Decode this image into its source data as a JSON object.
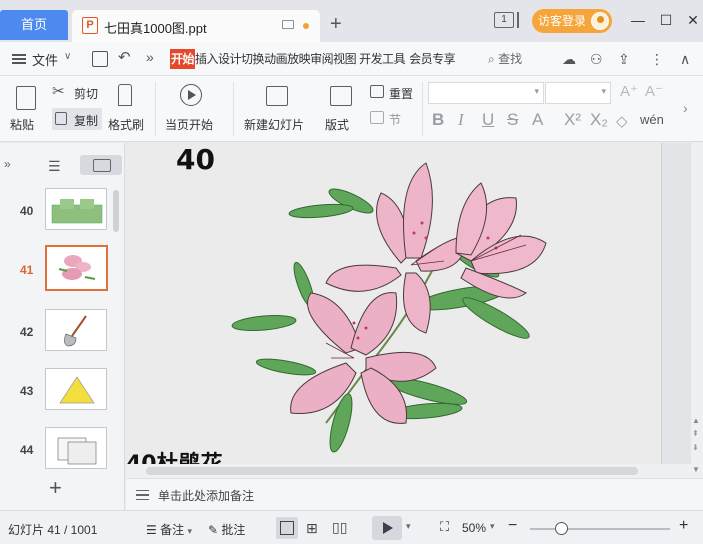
{
  "titlebar": {
    "home_tab": "首页",
    "doc_tab_title": "七田真1000图.ppt",
    "window_badge": "1",
    "login_label": "访客登录"
  },
  "menubar": {
    "file_label": "文件",
    "tabs": [
      {
        "label": "开始"
      },
      {
        "label": "插入"
      },
      {
        "label": "设计"
      },
      {
        "label": "切换"
      },
      {
        "label": "动画"
      },
      {
        "label": "放映"
      },
      {
        "label": "审阅"
      },
      {
        "label": "视图"
      },
      {
        "label": "开发工具"
      },
      {
        "label": "会员专享"
      }
    ],
    "search_label": "查找"
  },
  "ribbon": {
    "paste": "粘贴",
    "cut": "剪切",
    "copy": "复制",
    "format_painter": "格式刷",
    "from_current": "当页开始",
    "new_slide": "新建幻灯片",
    "layout": "版式",
    "reset": "重置",
    "section": "节",
    "font_name": "",
    "font_size": ""
  },
  "thumbnails": {
    "slides": [
      {
        "number": "40",
        "active": false
      },
      {
        "number": "41",
        "active": true
      },
      {
        "number": "42",
        "active": false
      },
      {
        "number": "43",
        "active": false
      },
      {
        "number": "44",
        "active": false
      }
    ]
  },
  "slide": {
    "number_text": "40",
    "caption": "40杜鹃花"
  },
  "notes": {
    "placeholder": "单击此处添加备注"
  },
  "statusbar": {
    "slide_counter": "幻灯片 41 / 1001",
    "notes_label": "备注",
    "comments_label": "批注",
    "zoom": "50%"
  }
}
